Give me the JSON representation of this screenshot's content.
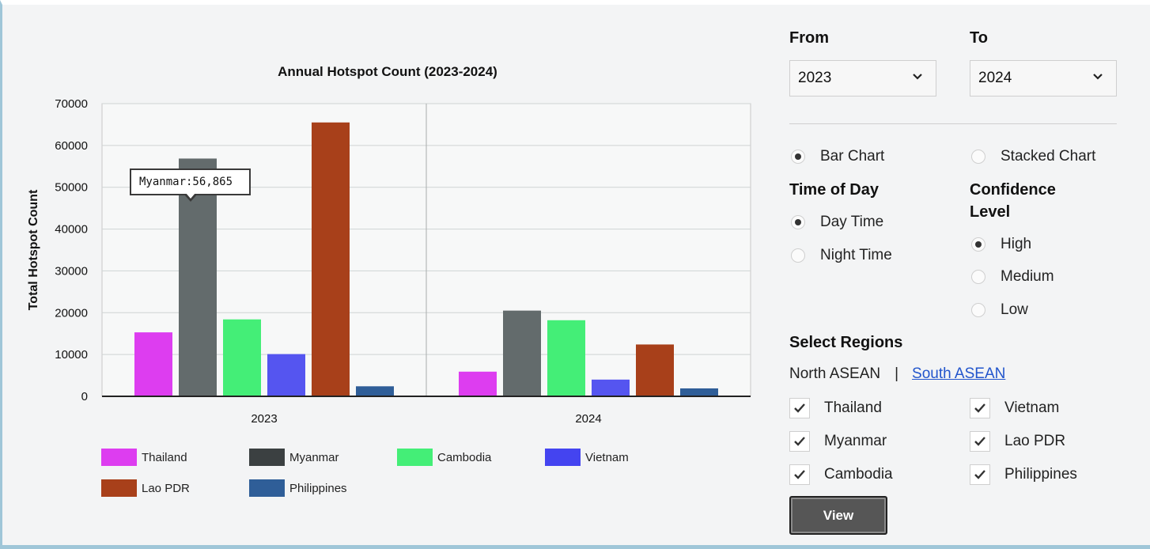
{
  "filters": {
    "from_label": "From",
    "to_label": "To",
    "from_value": "2023",
    "to_value": "2024"
  },
  "chart_type_options": {
    "bar": "Bar Chart",
    "stacked": "Stacked Chart",
    "selected": "bar"
  },
  "time_of_day": {
    "title": "Time of Day",
    "options": [
      "Day Time",
      "Night Time"
    ],
    "selected": "Day Time"
  },
  "confidence": {
    "title_line1": "Confidence",
    "title_line2": "Level",
    "options": [
      "High",
      "Medium",
      "Low"
    ],
    "selected": "High"
  },
  "regions": {
    "title": "Select Regions",
    "north": "North ASEAN",
    "separator": "|",
    "south": "South ASEAN",
    "countries": [
      {
        "name": "Thailand",
        "checked": true
      },
      {
        "name": "Vietnam",
        "checked": true
      },
      {
        "name": "Myanmar",
        "checked": true
      },
      {
        "name": "Lao PDR",
        "checked": true
      },
      {
        "name": "Cambodia",
        "checked": true
      },
      {
        "name": "Philippines",
        "checked": true
      }
    ]
  },
  "view_button": "View",
  "tooltip": "Myanmar:56,865",
  "chart_data": {
    "type": "bar",
    "title": "Annual Hotspot Count (2023-2024)",
    "xlabel": "",
    "ylabel": "Total Hotspot Count",
    "ylim": [
      0,
      70000
    ],
    "yticks": [
      0,
      10000,
      20000,
      30000,
      40000,
      50000,
      60000,
      70000
    ],
    "categories": [
      "2023",
      "2024"
    ],
    "grid": true,
    "legend_position": "bottom",
    "series": [
      {
        "name": "Thailand",
        "color": "#dd3df0",
        "values": [
          15300,
          5900
        ]
      },
      {
        "name": "Myanmar",
        "color": "#636b6c",
        "values": [
          56865,
          20500
        ]
      },
      {
        "name": "Cambodia",
        "color": "#44ee77",
        "values": [
          18400,
          18200
        ]
      },
      {
        "name": "Vietnam",
        "color": "#5555f0",
        "values": [
          10100,
          4000
        ]
      },
      {
        "name": "Lao PDR",
        "color": "#a8401a",
        "values": [
          65500,
          12400
        ]
      },
      {
        "name": "Philippines",
        "color": "#2f5e98",
        "values": [
          2400,
          1900
        ]
      }
    ],
    "legend_colors": [
      "#dd3df0",
      "#3b4041",
      "#44ee77",
      "#4444f0",
      "#a8401a",
      "#2f5e98"
    ]
  }
}
